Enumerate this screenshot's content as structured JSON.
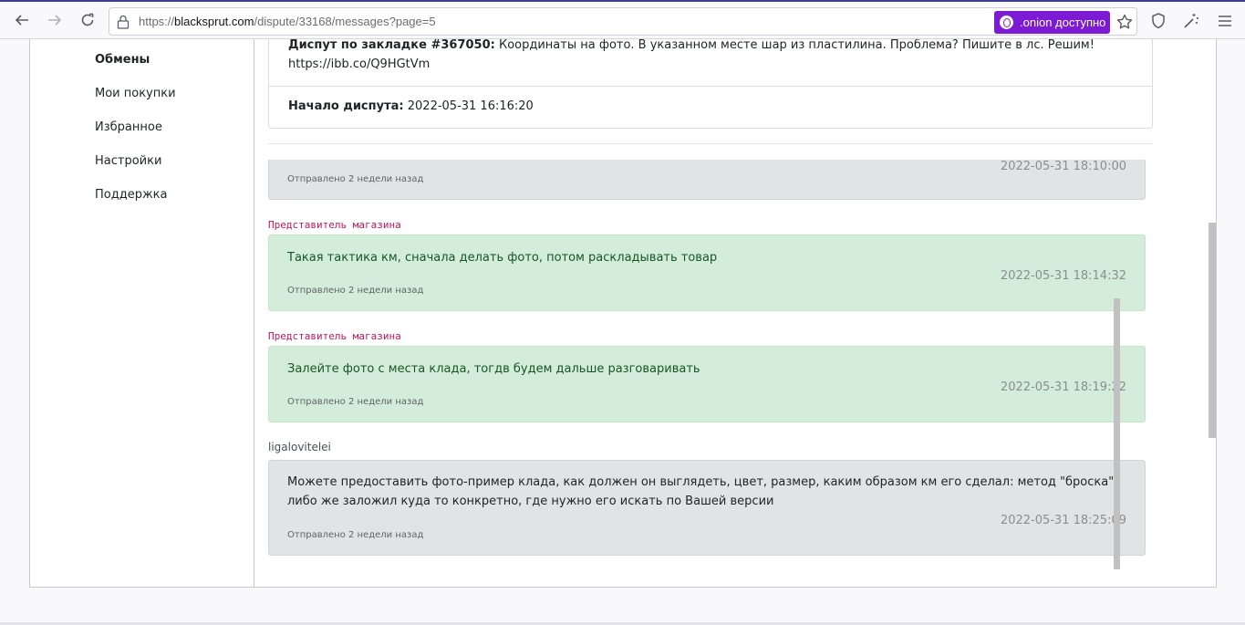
{
  "browser": {
    "url_prefix": "https://",
    "url_host": "blacksprut.com",
    "url_path": "/dispute/33168/messages?page=5",
    "onion_label": ".onion доступно"
  },
  "sidebar": {
    "items": [
      {
        "label": "Обмены",
        "active": true
      },
      {
        "label": "Мои покупки"
      },
      {
        "label": "Избранное"
      },
      {
        "label": "Настройки"
      },
      {
        "label": "Поддержка"
      }
    ]
  },
  "dispute": {
    "title_label": "Диспут по закладке #367050:",
    "title_text": "Координаты на фото. В указанном месте шар из пластилина. Проблема? Пишите в лс. Решим! https://ibb.co/Q9HGtVm",
    "start_label": "Начало диспута:",
    "start_value": "2022-05-31 16:16:20"
  },
  "messages": [
    {
      "author": "",
      "author_type": "user",
      "text": "",
      "time": "2022-05-31 18:10:00",
      "sent": "Отправлено 2 недели назад"
    },
    {
      "author": "Представитель магазина",
      "author_type": "shop",
      "text": "Такая тактика км, сначала делать фото, потом раскладывать товар",
      "time": "2022-05-31 18:14:32",
      "sent": "Отправлено 2 недели назад"
    },
    {
      "author": "Представитель магазина",
      "author_type": "shop",
      "text": "Залейте фото с места клада, тогдв будем дальше разговаривать",
      "time": "2022-05-31 18:19:22",
      "sent": "Отправлено 2 недели назад"
    },
    {
      "author": "ligalovitelei",
      "author_type": "user",
      "text": "Можете предоставить фото-пример клада, как должен он выглядеть, цвет, размер, каким образом км его сделал: метод \"броска\", либо же заложил куда то конкретно, где нужно его искать по Вашей версии",
      "time": "2022-05-31 18:25:09",
      "sent": "Отправлено 2 недели назад"
    }
  ],
  "colors": {
    "onion_button": "#7c1bd3",
    "shop_author": "#c2185b",
    "shop_message_bg": "#d4edda",
    "user_message_bg": "#e2e3e5"
  }
}
